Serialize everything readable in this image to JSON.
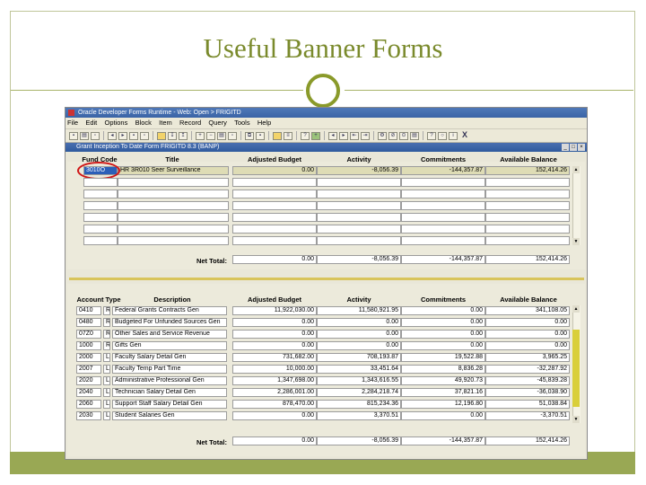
{
  "slide": {
    "title": "Useful Banner Forms"
  },
  "app": {
    "window_title": "Oracle Developer Forms Runtime - Web: Open > FRIGITD",
    "menu": [
      "File",
      "Edit",
      "Options",
      "Block",
      "Item",
      "Record",
      "Query",
      "Tools",
      "Help"
    ],
    "form_title": "Grant Inception To Date Form  FRIGITD  8.3  (BANP)"
  },
  "top": {
    "headers": {
      "fund_code": "Fund Code",
      "title": "Title",
      "adjusted_budget": "Adjusted Budget",
      "activity": "Activity",
      "commitments": "Commitments",
      "available_balance": "Available Balance"
    },
    "rows": [
      {
        "fund_code": "3010O",
        "title": "HR 3R010 Seer Surveillance",
        "adjusted_budget": "0.00",
        "activity": "-8,056.39",
        "commitments": "-144,357.87",
        "available_balance": "152,414.26"
      }
    ],
    "net_total_label": "Net Total:",
    "net_total": {
      "adjusted_budget": "0.00",
      "activity": "-8,056.39",
      "commitments": "-144,357.87",
      "available_balance": "152,414.26"
    }
  },
  "bottom": {
    "headers": {
      "account_type": "Account Type",
      "description": "Description",
      "adjusted_budget": "Adjusted Budget",
      "activity": "Activity",
      "commitments": "Commitments",
      "available_balance": "Available Balance"
    },
    "rows": [
      {
        "account": "0410",
        "type": "R",
        "description": "Federal Grants Contracts Gen",
        "adjusted_budget": "11,922,030.00",
        "activity": "11,580,921.95",
        "commitments": "0.00",
        "available_balance": "341,108.05"
      },
      {
        "account": "0480",
        "type": "R",
        "description": "Budgeted For Unfunded Sources Gen",
        "adjusted_budget": "0.00",
        "activity": "0.00",
        "commitments": "0.00",
        "available_balance": "0.00"
      },
      {
        "account": "07Z0",
        "type": "R",
        "description": "Other Sales and Service Revenue",
        "adjusted_budget": "0.00",
        "activity": "0.00",
        "commitments": "0.00",
        "available_balance": "0.00"
      },
      {
        "account": "1000",
        "type": "R",
        "description": "Gifts Gen",
        "adjusted_budget": "0.00",
        "activity": "0.00",
        "commitments": "0.00",
        "available_balance": "0.00"
      },
      {
        "account": "2000",
        "type": "L",
        "description": "Faculty Salary Detail Gen",
        "adjusted_budget": "731,682.00",
        "activity": "708,193.87",
        "commitments": "19,522.88",
        "available_balance": "3,965.25"
      },
      {
        "account": "2007",
        "type": "L",
        "description": "Faculty Temp Part Time",
        "adjusted_budget": "10,000.00",
        "activity": "33,451.64",
        "commitments": "8,836.28",
        "available_balance": "-32,287.92"
      },
      {
        "account": "2020",
        "type": "L",
        "description": "Administrative Professional Gen",
        "adjusted_budget": "1,347,698.00",
        "activity": "1,343,616.55",
        "commitments": "49,920.73",
        "available_balance": "-45,839.28"
      },
      {
        "account": "2040",
        "type": "L",
        "description": "Technician Salary Detail Gen",
        "adjusted_budget": "2,286,001.00",
        "activity": "2,284,218.74",
        "commitments": "37,821.16",
        "available_balance": "-36,038.90"
      },
      {
        "account": "2060",
        "type": "L",
        "description": "Support Staff Salary Detail Gen",
        "adjusted_budget": "878,470.00",
        "activity": "815,234.36",
        "commitments": "12,196.80",
        "available_balance": "51,038.84"
      },
      {
        "account": "2030",
        "type": "L",
        "description": "Student Salaries Gen",
        "adjusted_budget": "0.00",
        "activity": "3,370.51",
        "commitments": "0.00",
        "available_balance": "-3,370.51"
      }
    ],
    "net_total_label": "Net Total:",
    "net_total": {
      "adjusted_budget": "0.00",
      "activity": "-8,056.39",
      "commitments": "-144,357.87",
      "available_balance": "152,414.26"
    }
  },
  "colors": {
    "accent": "#7a8a2c",
    "band": "#99a854",
    "selection": "#2b5fb8",
    "annotation": "#d01818"
  }
}
